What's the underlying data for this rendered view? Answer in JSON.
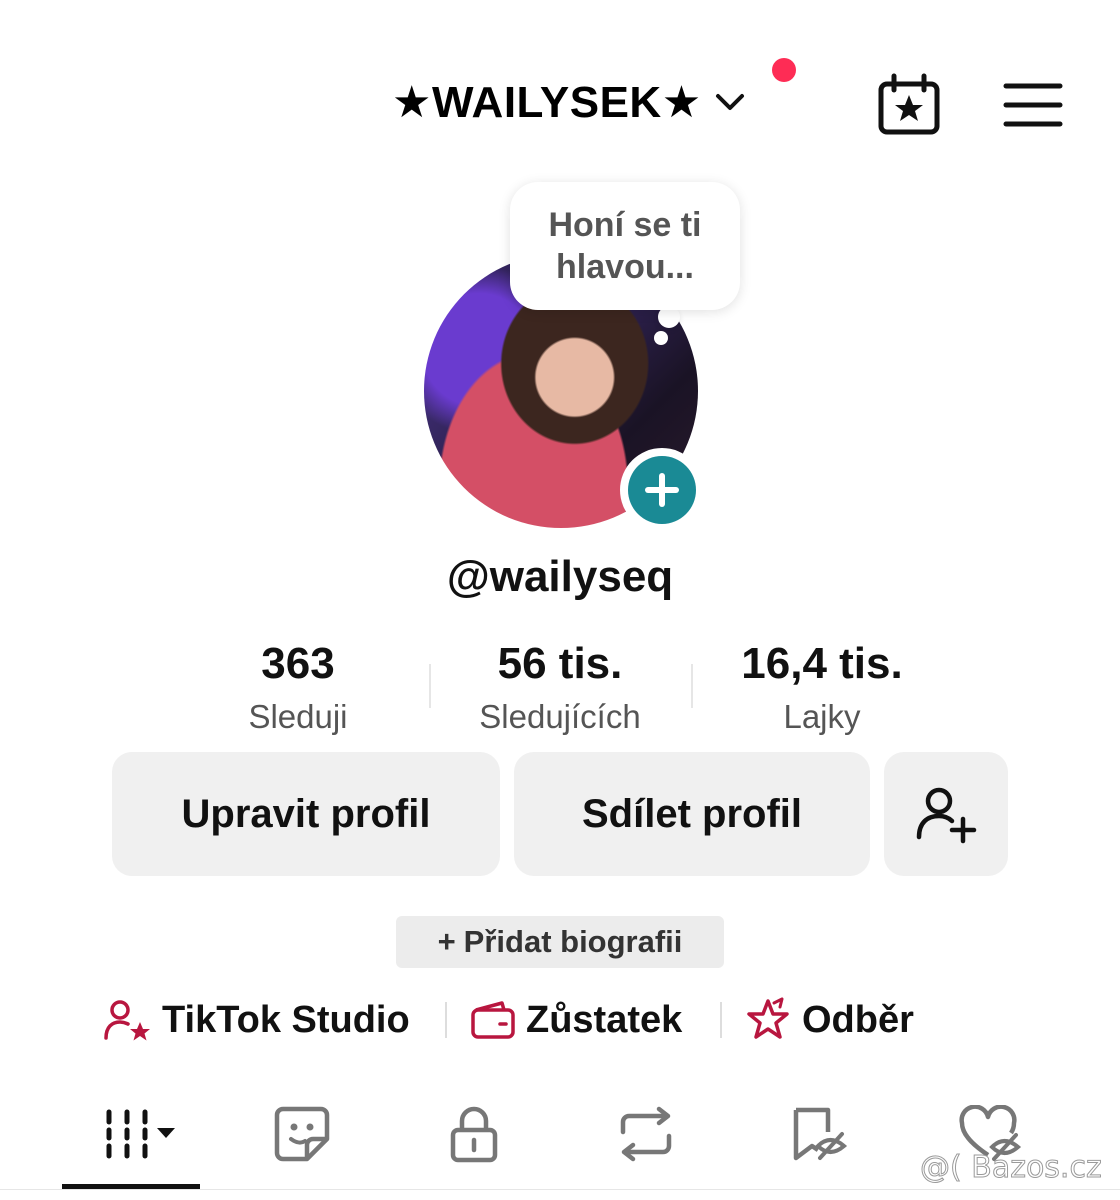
{
  "header": {
    "account_title": "★WAILYSEK★",
    "icons": [
      "chevron-down-icon",
      "calendar-star-icon",
      "hamburger-menu-icon"
    ],
    "notification_dot_color": "#fe2c55"
  },
  "profile": {
    "bubble_line1": "Honí se ti",
    "bubble_line2": "hlavou...",
    "handle": "@wailyseq",
    "accent_color": "#1a8a95"
  },
  "stats": [
    {
      "value": "363",
      "label": "Sleduji"
    },
    {
      "value": "56 tis.",
      "label": "Sledujících"
    },
    {
      "value": "16,4 tis.",
      "label": "Lajky"
    }
  ],
  "buttons": {
    "edit_profile": "Upravit profil",
    "share_profile": "Sdílet profil",
    "add_friend_icon": "add-person-icon"
  },
  "bio": {
    "plus": "+",
    "label": "Přidat biografii"
  },
  "links": [
    {
      "label": "TikTok Studio",
      "icon": "person-star-icon"
    },
    {
      "label": "Zůstatek",
      "icon": "wallet-icon"
    },
    {
      "label": "Odběr",
      "icon": "subscription-star-icon"
    }
  ],
  "link_icon_color": "#b8163f",
  "tabs": [
    {
      "icon": "videos-grid-icon",
      "selected": true
    },
    {
      "icon": "sticker-icon"
    },
    {
      "icon": "lock-icon"
    },
    {
      "icon": "repost-icon"
    },
    {
      "icon": "bookmark-hidden-icon"
    },
    {
      "icon": "heart-hidden-icon"
    }
  ],
  "watermark": "@( Bazos.cz"
}
